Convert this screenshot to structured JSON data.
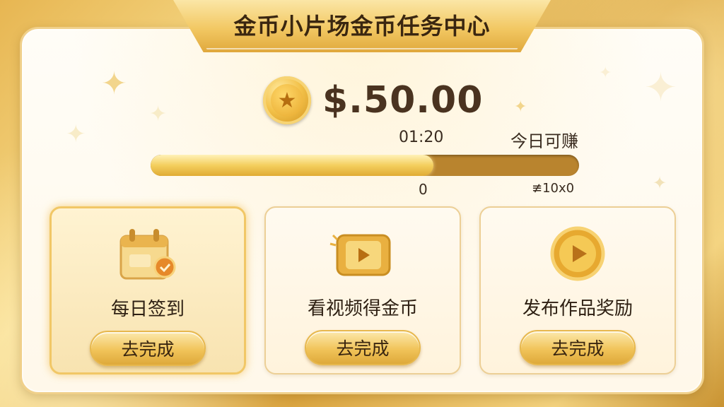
{
  "header": {
    "title": "金币小片场金币任务中心"
  },
  "balance": {
    "amount": "$.50.00",
    "coin_icon": "star-coin-icon"
  },
  "progress": {
    "timer": "01:20",
    "today_label": "今日可赚",
    "fraction": 0.66,
    "min_label": "0",
    "max_label": "≢10x0"
  },
  "tasks": [
    {
      "label": "每日签到",
      "button": "去完成",
      "icon": "calendar-icon",
      "active": true
    },
    {
      "label": "看视频得金币",
      "button": "去完成",
      "icon": "video-play-icon",
      "active": false
    },
    {
      "label": "发布作品奖励",
      "button": "去完成",
      "icon": "play-coin-icon",
      "active": false
    }
  ],
  "colors": {
    "accent": "#f1c45a",
    "track": "#b9842e",
    "text": "#3a2610"
  }
}
